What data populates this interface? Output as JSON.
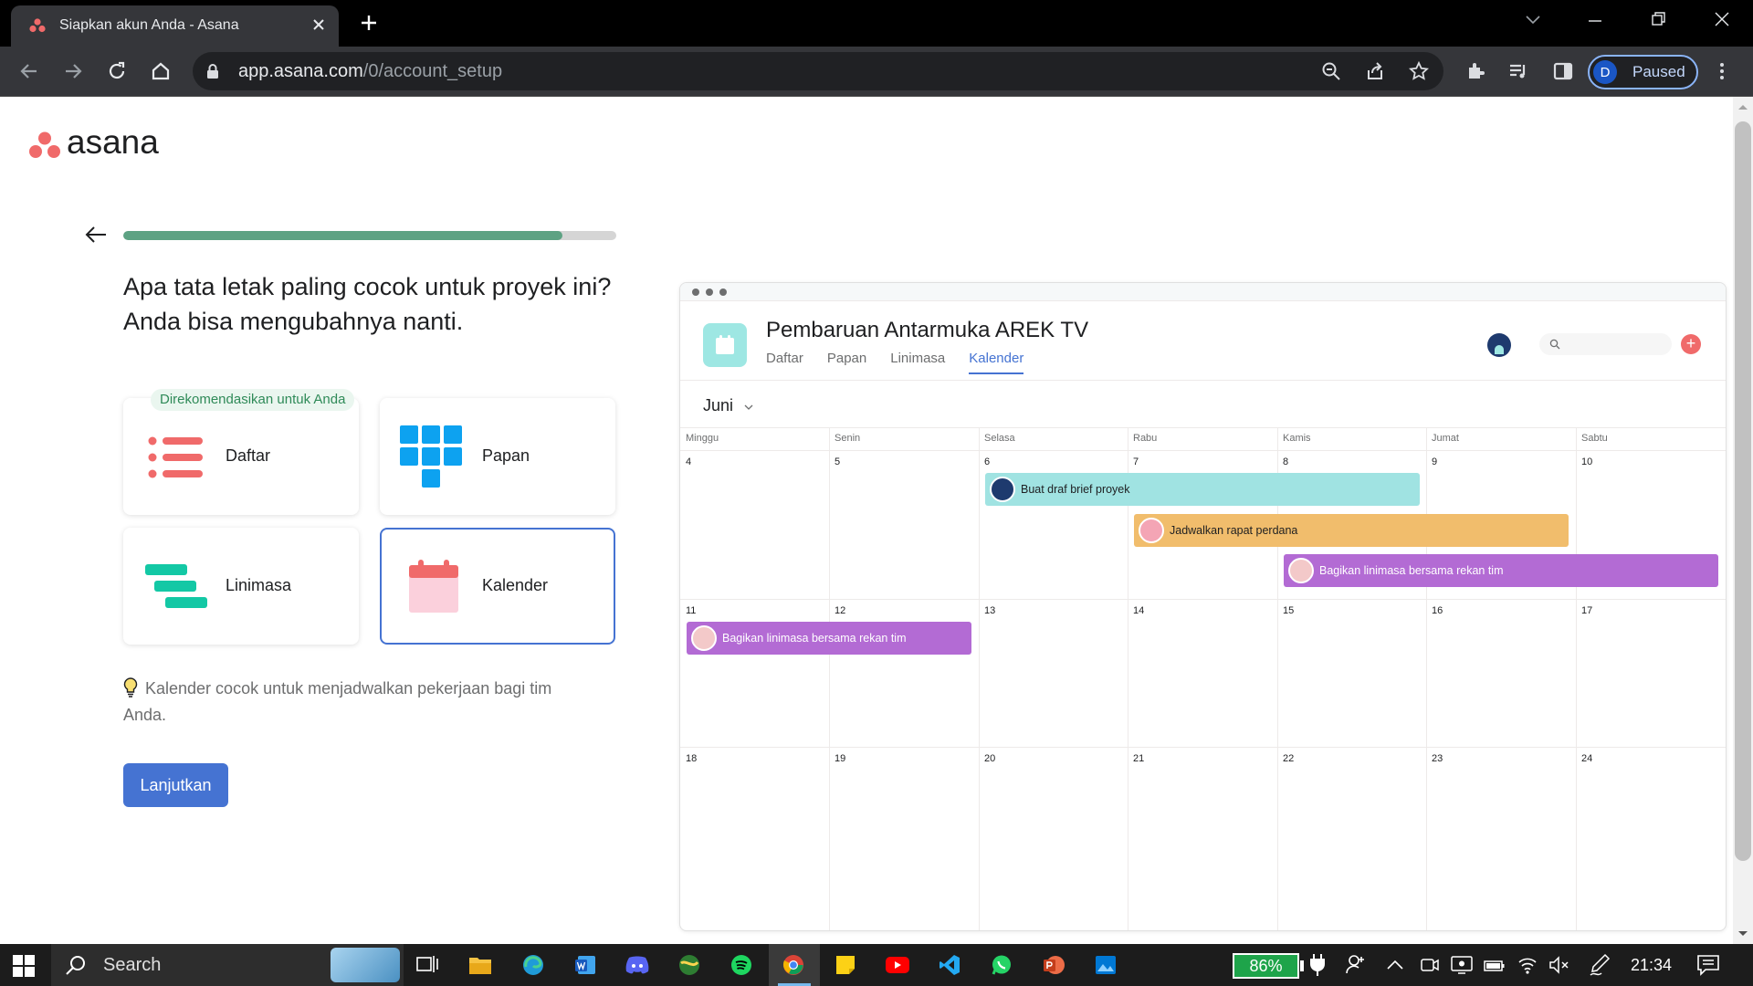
{
  "browser": {
    "tab_title": "Siapkan akun Anda - Asana",
    "url_host": "app.asana.com",
    "url_path": "/0/account_setup",
    "profile_initial": "D",
    "profile_status": "Paused"
  },
  "page": {
    "logo_text": "asana",
    "progress_fraction": 0.89,
    "question": "Apa tata letak paling cocok untuk proyek ini? Anda bisa mengubahnya nanti.",
    "recommended_badge": "Direkomendasikan untuk Anda",
    "layouts": [
      {
        "label": "Daftar",
        "icon": "list-icon"
      },
      {
        "label": "Papan",
        "icon": "board-icon"
      },
      {
        "label": "Linimasa",
        "icon": "timeline-icon"
      },
      {
        "label": "Kalender",
        "icon": "calendar-icon",
        "selected": true
      }
    ],
    "hint": "Kalender cocok untuk menjadwalkan pekerjaan bagi tim Anda.",
    "continue_button": "Lanjutkan"
  },
  "preview": {
    "project_title": "Pembaruan Antarmuka AREK TV",
    "tabs": [
      "Daftar",
      "Papan",
      "Linimasa",
      "Kalender"
    ],
    "active_tab": "Kalender",
    "month": "Juni",
    "weekdays": [
      "Minggu",
      "Senin",
      "Selasa",
      "Rabu",
      "Kamis",
      "Jumat",
      "Sabtu"
    ],
    "weeks": [
      [
        "4",
        "5",
        "6",
        "7",
        "8",
        "9",
        "10"
      ],
      [
        "11",
        "12",
        "13",
        "14",
        "15",
        "16",
        "17"
      ],
      [
        "18",
        "19",
        "20",
        "21",
        "22",
        "23",
        "24"
      ]
    ],
    "events": [
      {
        "title": "Buat draf brief proyek",
        "color": "#a0e3e2"
      },
      {
        "title": "Jadwalkan rapat perdana",
        "color": "#f1bd6c"
      },
      {
        "title": "Bagikan linimasa bersama rekan tim",
        "color": "#b36bd4"
      },
      {
        "title": "Bagikan linimasa bersama rekan tim",
        "color": "#b36bd4"
      }
    ]
  },
  "taskbar": {
    "search_placeholder": "Search",
    "battery": "86%",
    "time": "21:34"
  },
  "colors": {
    "accent": "#4573d2",
    "progress": "#5da283",
    "asana_coral": "#f06a6a"
  }
}
